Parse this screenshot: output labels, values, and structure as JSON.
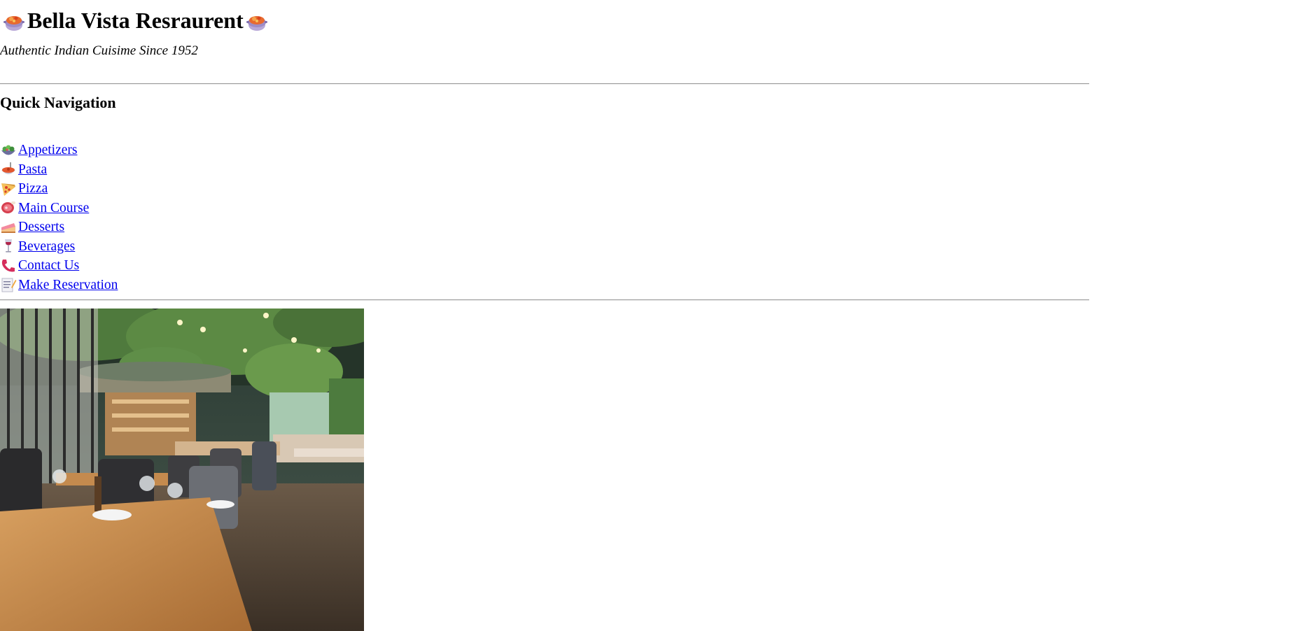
{
  "header": {
    "title": "Bella Vista Resraurent",
    "title_icon": "cooking-pot-icon",
    "tagline": "Authentic Indian Cuisime Since 1952"
  },
  "nav": {
    "heading": "Quick Navigation",
    "items": [
      {
        "label": "Appetizers",
        "icon": "salad-icon"
      },
      {
        "label": "Pasta",
        "icon": "spaghetti-icon"
      },
      {
        "label": "Pizza",
        "icon": "pizza-icon"
      },
      {
        "label": "Main Course",
        "icon": "meat-icon"
      },
      {
        "label": "Desserts",
        "icon": "cake-icon"
      },
      {
        "label": "Beverages",
        "icon": "wine-glass-icon"
      },
      {
        "label": "Contact Us",
        "icon": "telephone-icon"
      },
      {
        "label": "Make Reservation",
        "icon": "memo-icon"
      }
    ]
  },
  "colors": {
    "link": "#0000ee",
    "text": "#000000",
    "rule": "#9a9a9a"
  },
  "hero": {
    "image": "restaurant-interior-photo"
  }
}
